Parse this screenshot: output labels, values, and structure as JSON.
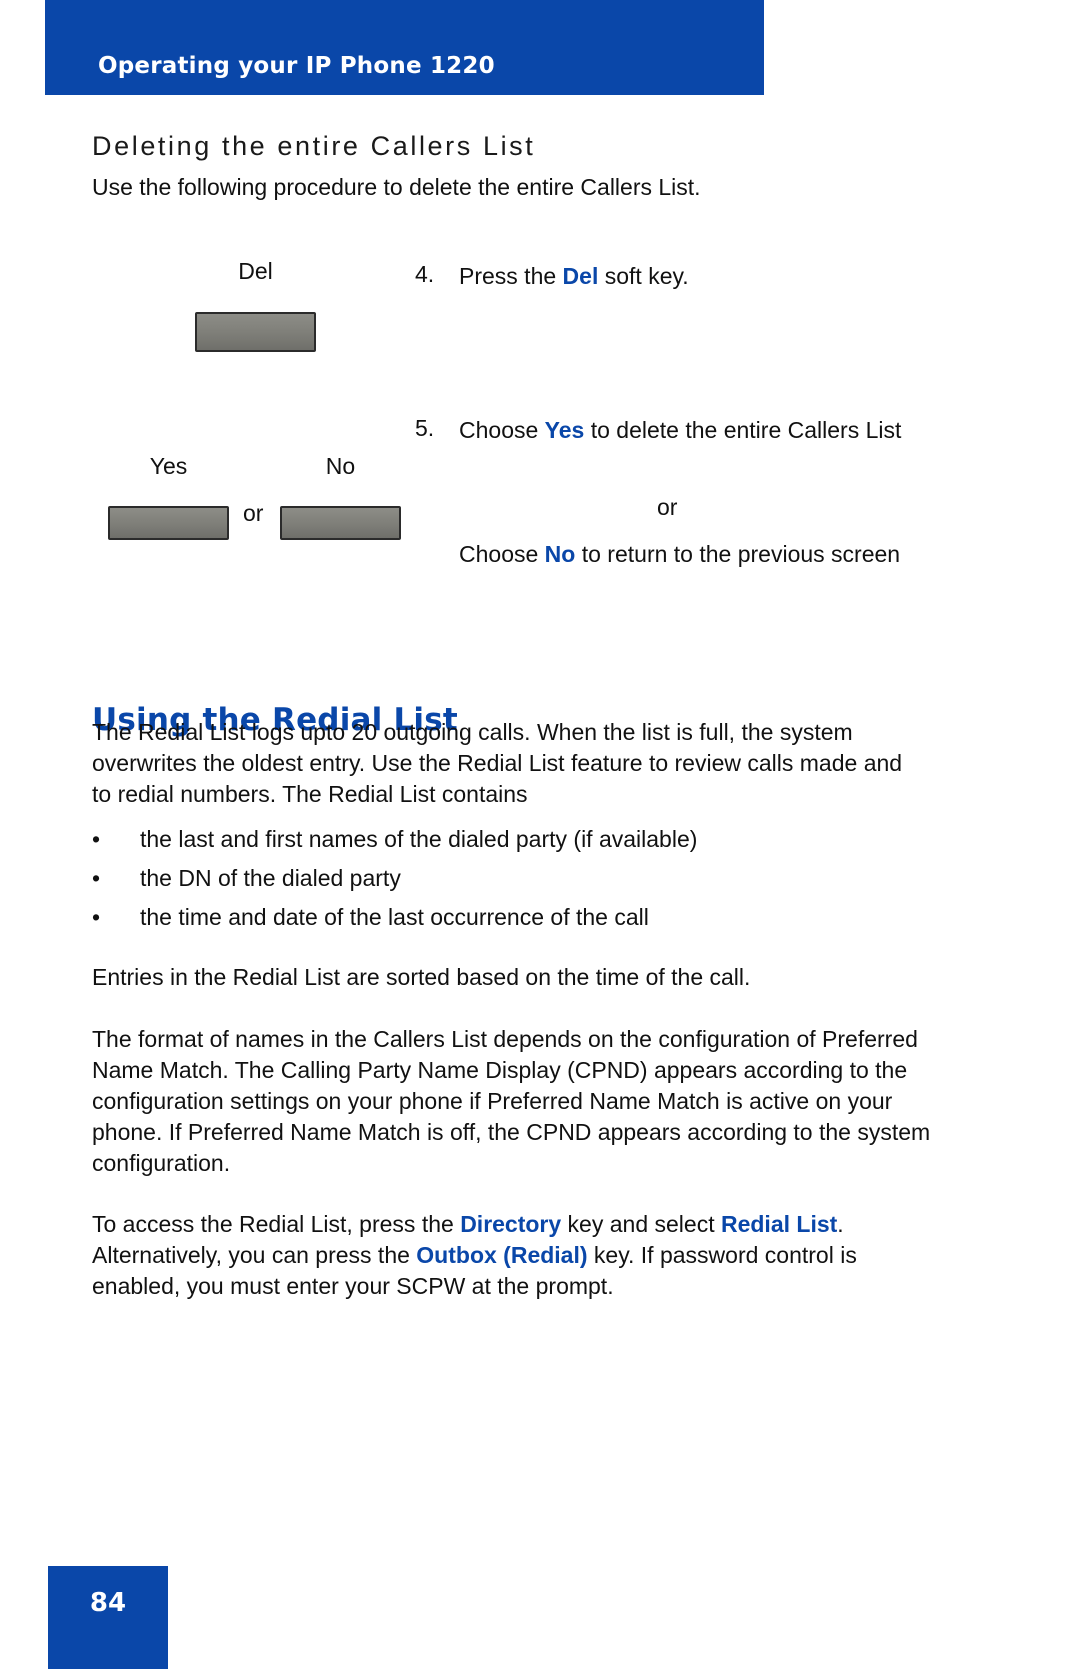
{
  "header": {
    "title": "Operating your IP Phone 1220",
    "band_color": "#0A47A9"
  },
  "section": {
    "heading": "Deleting the entire Callers List",
    "intro": "Use the following procedure to delete the entire Callers List."
  },
  "steps": [
    {
      "number": "4.",
      "graphic_labels": [
        "Del"
      ],
      "text_prefix": "Press the ",
      "highlight": "Del",
      "text_suffix": " soft key."
    },
    {
      "number": "5.",
      "graphic_labels": [
        "Yes",
        "No"
      ],
      "graphic_separator": "or",
      "line1_prefix": "Choose ",
      "line1_highlight": "Yes",
      "line1_suffix": " to delete the entire Callers List",
      "separator": "or",
      "line2_prefix": "Choose ",
      "line2_highlight": "No",
      "line2_suffix": " to return to the previous screen"
    }
  ],
  "redial": {
    "heading": "Using the Redial List",
    "paragraph1": "The Redial List logs upto 20 outgoing calls. When the list is full, the system overwrites the oldest entry. Use the Redial List feature to review calls made and to redial numbers. The Redial List contains",
    "bullet_marker": "•",
    "bullets": [
      "the last and first names of the dialed party (if available)",
      "the DN of the dialed party",
      "the time and date of the last occurrence of the call"
    ],
    "paragraph2": "Entries in the Redial List are sorted based on the time of the call.",
    "paragraph3": "The format of names in the Callers List depends on the configuration of Preferred Name Match. The Calling Party Name Display (CPND) appears according to the configuration settings on your phone if Preferred Name Match is active on your phone. If Preferred Name Match is off, the CPND appears according to the system configuration.",
    "paragraph4": {
      "part1": "To access the Redial List, press the ",
      "bold1": "Directory",
      "part2": " key and select ",
      "bold2": "Redial List",
      "part3": ". Alternatively, you can press the ",
      "bold3": "Outbox (Redial)",
      "part4": " key. If password control is enabled, you must enter your SCPW at the prompt."
    }
  },
  "footer": {
    "page_number": "84",
    "band_color": "#0A47A9"
  },
  "colors": {
    "brand_blue": "#0A47A9",
    "body_text": "#111111",
    "softkey_face": "#7e7e78",
    "softkey_border": "#2b2b2b"
  }
}
